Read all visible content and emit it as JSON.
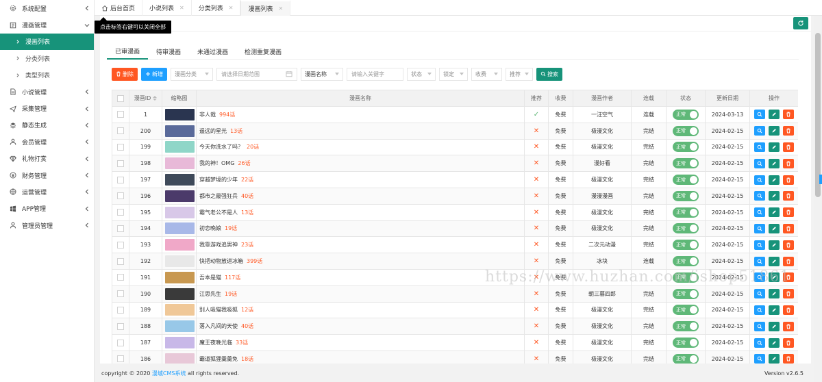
{
  "sidebar": {
    "items": [
      {
        "label": "系统配置",
        "icon": "gear-icon",
        "expanded": false
      },
      {
        "label": "漫画管理",
        "icon": "book-icon",
        "expanded": true,
        "children": [
          {
            "label": "漫画列表",
            "active": true
          },
          {
            "label": "分类列表",
            "active": false
          },
          {
            "label": "类型列表",
            "active": false
          }
        ]
      },
      {
        "label": "小说管理",
        "icon": "doc-icon",
        "expanded": false
      },
      {
        "label": "采集管理",
        "icon": "send-icon",
        "expanded": false
      },
      {
        "label": "静态生成",
        "icon": "layers-icon",
        "expanded": false
      },
      {
        "label": "会员管理",
        "icon": "users-icon",
        "expanded": false
      },
      {
        "label": "礼物打赏",
        "icon": "diamond-icon",
        "expanded": false
      },
      {
        "label": "财务管理",
        "icon": "yen-icon",
        "expanded": false
      },
      {
        "label": "运营管理",
        "icon": "globe-icon",
        "expanded": false
      },
      {
        "label": "APP管理",
        "icon": "windows-icon",
        "expanded": false
      },
      {
        "label": "管理员管理",
        "icon": "user-icon",
        "expanded": false
      }
    ]
  },
  "tabs": [
    {
      "label": "后台首页",
      "closable": false,
      "active": false
    },
    {
      "label": "小说列表",
      "closable": true,
      "active": false
    },
    {
      "label": "分类列表",
      "closable": true,
      "active": false
    },
    {
      "label": "漫画列表",
      "closable": true,
      "active": true
    }
  ],
  "tab_close_glyph": "✕",
  "tooltip": "点击标签右键可以关闭全部",
  "subtabs": [
    "已审漫画",
    "待审漫画",
    "未通过漫画",
    "检测重复漫画"
  ],
  "toolbar": {
    "delete_label": "删除",
    "add_label": "新增",
    "category_placeholder": "漫画分类",
    "date_placeholder": "请选择日期范围",
    "field_select": "漫画名称",
    "keyword_placeholder": "请输入关键字",
    "status_select": "状态",
    "lock_select": "锁定",
    "fee_select": "收费",
    "recommend_select": "推荐",
    "search_label": "搜索"
  },
  "table": {
    "headers": [
      "漫画ID",
      "缩略图",
      "漫画名称",
      "推荐",
      "收费",
      "漫画作者",
      "连载",
      "状态",
      "更新日期",
      "操作"
    ],
    "status_label": "正常",
    "yes_glyph": "✓",
    "no_glyph": "✕",
    "rows": [
      {
        "id": "1",
        "name": "非人哉",
        "chapters": "994话",
        "recommend": true,
        "fee": "免费",
        "author": "一汪空气",
        "serial": "连载",
        "date": "2024-03-13",
        "thumb": "#2a3550"
      },
      {
        "id": "200",
        "name": "遥远的星光",
        "chapters": "13话",
        "recommend": false,
        "fee": "免费",
        "author": "极漫文化",
        "serial": "完结",
        "date": "2024-02-15",
        "thumb": "#5a6a9a"
      },
      {
        "id": "199",
        "name": "今天你洗水了吗？",
        "chapters": "20话",
        "recommend": false,
        "fee": "免费",
        "author": "极漫文化",
        "serial": "完结",
        "date": "2024-02-15",
        "thumb": "#8fd6c8"
      },
      {
        "id": "198",
        "name": "我的神！OMG",
        "chapters": "26话",
        "recommend": false,
        "fee": "免费",
        "author": "漫好看",
        "serial": "完结",
        "date": "2024-02-15",
        "thumb": "#e8b9d8"
      },
      {
        "id": "197",
        "name": "穿越梦境的少年",
        "chapters": "22话",
        "recommend": false,
        "fee": "免费",
        "author": "极漫文化",
        "serial": "完结",
        "date": "2024-02-15",
        "thumb": "#3f4a5a"
      },
      {
        "id": "196",
        "name": "都市之最强狂兵",
        "chapters": "40话",
        "recommend": false,
        "fee": "免费",
        "author": "漫漫漫画",
        "serial": "完结",
        "date": "2024-02-15",
        "thumb": "#4b3a6a"
      },
      {
        "id": "195",
        "name": "霸气老公不是人",
        "chapters": "13话",
        "recommend": false,
        "fee": "免费",
        "author": "极漫文化",
        "serial": "完结",
        "date": "2024-02-15",
        "thumb": "#d8c8e8"
      },
      {
        "id": "194",
        "name": "初恋晚娘",
        "chapters": "19话",
        "recommend": false,
        "fee": "免费",
        "author": "极漫文化",
        "serial": "完结",
        "date": "2024-02-15",
        "thumb": "#a8b8e8"
      },
      {
        "id": "193",
        "name": "我靠游戏追男神",
        "chapters": "23话",
        "recommend": false,
        "fee": "免费",
        "author": "二次元动漫",
        "serial": "完结",
        "date": "2024-02-15",
        "thumb": "#f0a8c8"
      },
      {
        "id": "192",
        "name": "快把动物放进冰箱",
        "chapters": "399话",
        "recommend": false,
        "fee": "免费",
        "author": "冰块",
        "serial": "连载",
        "date": "2024-02-15",
        "thumb": "#e8e8e8"
      },
      {
        "id": "191",
        "name": "吾本是猫",
        "chapters": "117话",
        "recommend": false,
        "fee": "免费",
        "author": "",
        "serial": "",
        "date": "2024-02-15",
        "thumb": "#c89850"
      },
      {
        "id": "190",
        "name": "江思先生",
        "chapters": "19话",
        "recommend": false,
        "fee": "免费",
        "author": "朝三暮四郎",
        "serial": "完结",
        "date": "2024-02-15",
        "thumb": "#3a3a3a"
      },
      {
        "id": "189",
        "name": "别人吸猫我吸狐",
        "chapters": "12话",
        "recommend": false,
        "fee": "免费",
        "author": "极漫文化",
        "serial": "完结",
        "date": "2024-02-15",
        "thumb": "#f0c898"
      },
      {
        "id": "188",
        "name": "落入凡间的天使",
        "chapters": "40话",
        "recommend": false,
        "fee": "免费",
        "author": "极漫文化",
        "serial": "完结",
        "date": "2024-02-15",
        "thumb": "#98c8e8"
      },
      {
        "id": "187",
        "name": "魔王夜晚光临",
        "chapters": "33话",
        "recommend": false,
        "fee": "免费",
        "author": "极漫文化",
        "serial": "完结",
        "date": "2024-02-15",
        "thumb": "#c8b8e8"
      },
      {
        "id": "186",
        "name": "霸道狐狸羹羹免",
        "chapters": "18话",
        "recommend": false,
        "fee": "免费",
        "author": "极漫文化",
        "serial": "完结",
        "date": "2024-02-15",
        "thumb": "#e8c8d8"
      }
    ]
  },
  "footer": {
    "prefix": "copyright © 2020 ",
    "brand": "漫城CMS系统",
    "suffix": " all rights reserved.",
    "version": "Version v2.6.5"
  },
  "watermark": "https://www.huzhan.com/ishop51861",
  "colors": {
    "primary": "#17937a",
    "danger": "#ff5722",
    "info": "#1e9fff",
    "success": "#5fb878"
  }
}
